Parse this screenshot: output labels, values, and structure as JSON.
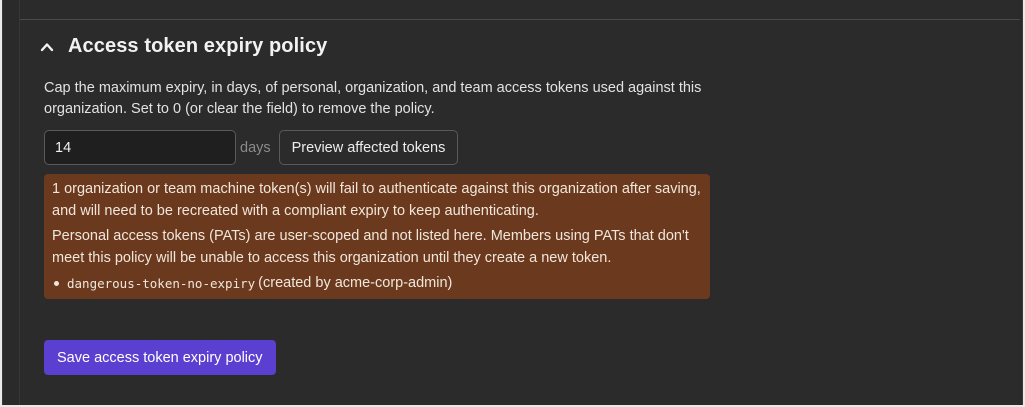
{
  "section": {
    "title": "Access token expiry policy",
    "chevron_icon": "chevron-up-icon",
    "description": "Cap the maximum expiry, in days, of personal, organization, and team access tokens used against this organization. Set to 0 (or clear the field) to remove the policy."
  },
  "expiry": {
    "value": "14",
    "unit": "days",
    "preview_label": "Preview affected tokens"
  },
  "warning": {
    "machine_tokens_text": "1 organization or team machine token(s) will fail to authenticate against this organization after saving, and will need to be recreated with a compliant expiry to keep authenticating.",
    "pat_text": "Personal access tokens (PATs) are user-scoped and not listed here. Members using PATs that don't meet this policy will be unable to access this organization until they create a new token.",
    "tokens": [
      {
        "name": "dangerous-token-no-expiry",
        "meta": "(created by acme-corp-admin)"
      }
    ],
    "background": "#6b3a1e"
  },
  "save": {
    "label": "Save access token expiry policy",
    "color": "#5b3fd0"
  }
}
